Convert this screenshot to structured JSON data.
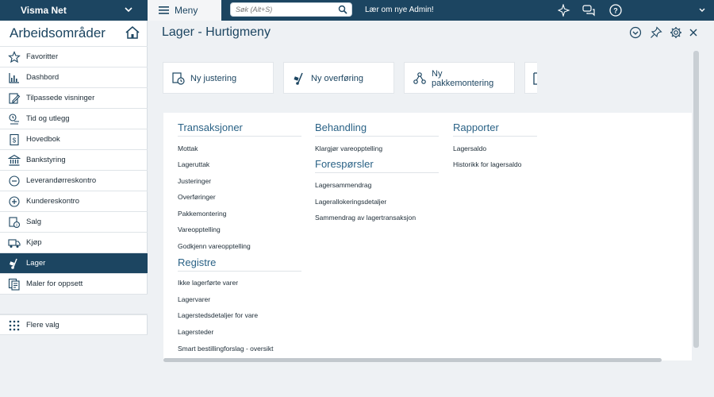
{
  "topbar": {
    "company": "Visma Net",
    "menu_label": "Meny",
    "search_placeholder": "Søk (Alt+S)",
    "news": "Lær om nye Admin!"
  },
  "sidebar": {
    "title": "Arbeidsområder",
    "items": [
      {
        "label": "Favoritter",
        "icon": "star-icon"
      },
      {
        "label": "Dashbord",
        "icon": "chart-icon"
      },
      {
        "label": "Tilpassede visninger",
        "icon": "edit-doc-icon"
      },
      {
        "label": "Tid og utlegg",
        "icon": "time-icon"
      },
      {
        "label": "Hovedbok",
        "icon": "ledger-icon"
      },
      {
        "label": "Bankstyring",
        "icon": "bank-icon"
      },
      {
        "label": "Leverandørreskontro",
        "icon": "minus-circle-icon"
      },
      {
        "label": "Kundereskontro",
        "icon": "plus-circle-icon"
      },
      {
        "label": "Salg",
        "icon": "sales-icon"
      },
      {
        "label": "Kjøp",
        "icon": "truck-icon"
      },
      {
        "label": "Lager",
        "icon": "dolly-icon"
      },
      {
        "label": "Maler for oppsett",
        "icon": "template-icon"
      },
      {
        "label": "Flere valg",
        "icon": "grid-icon"
      }
    ]
  },
  "main": {
    "title": "Lager - Hurtigmeny",
    "tiles": [
      {
        "label": "Ny justering"
      },
      {
        "label": "Ny overføring"
      },
      {
        "label": "Ny",
        "label2": "pakkemontering"
      }
    ],
    "columns": {
      "transaksjoner": {
        "title": "Transaksjoner",
        "links": [
          "Mottak",
          "Lageruttak",
          "Justeringer",
          "Overføringer",
          "Pakkemontering",
          "Vareopptelling",
          "Godkjenn vareopptelling"
        ]
      },
      "registre": {
        "title": "Registre",
        "links": [
          "Ikke lagerførte varer",
          "Lagervarer",
          "Lagerstedsdetaljer for vare",
          "Lagersteder",
          "Smart bestillingforslag - oversikt"
        ]
      },
      "behandling": {
        "title": "Behandling",
        "links": [
          "Klargjør vareopptelling"
        ]
      },
      "foresporsler": {
        "title": "Forespørsler",
        "links": [
          "Lagersammendrag",
          "Lagerallokeringsdetaljer",
          "Sammendrag av lagertransaksjon"
        ]
      },
      "rapporter": {
        "title": "Rapporter",
        "links": [
          "Lagersaldo",
          "Historikk for lagersaldo"
        ]
      }
    }
  },
  "colors": {
    "navy": "#1c4561",
    "link_heading": "#2a6286",
    "background": "#eef1f4"
  }
}
